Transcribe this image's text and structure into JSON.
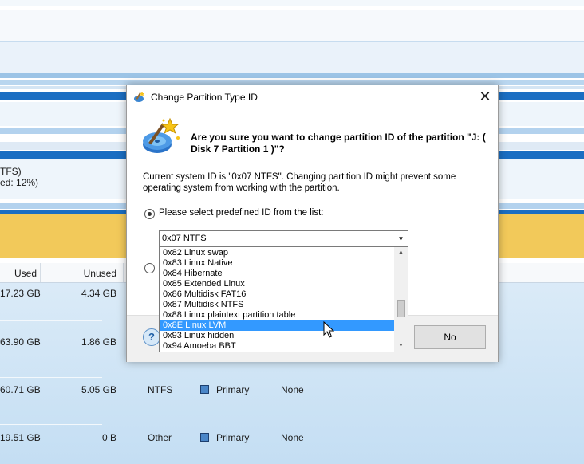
{
  "background": {
    "partition_text_line1": "TFS)",
    "partition_text_line2": "ed: 12%)",
    "columns": {
      "used": "Used",
      "unused": "Unused"
    },
    "rows": [
      {
        "used": "17.23 GB",
        "unused": "4.34 GB",
        "fs": "",
        "type": "",
        "status": ""
      },
      {
        "used": "63.90 GB",
        "unused": "1.86 GB",
        "fs": "",
        "type": "",
        "status": ""
      },
      {
        "used": "60.71 GB",
        "unused": "5.05 GB",
        "fs": "NTFS",
        "type": "Primary",
        "status": "None"
      },
      {
        "used": "19.51 GB",
        "unused": "0 B",
        "fs": "Other",
        "type": "Primary",
        "status": "None"
      }
    ]
  },
  "dialog": {
    "title": "Change Partition Type ID",
    "question": "Are you sure you want to change partition ID of the partition \"J: ( Disk 7 Partition 1 )\"?",
    "info": "Current system ID is \"0x07 NTFS\". Changing partition ID might prevent some operating system from working with the partition.",
    "radio_predefined_label": "Please select predefined ID from the list:",
    "combo_value": "0x07 NTFS",
    "dropdown_items": [
      "0x82 Linux swap",
      "0x83 Linux Native",
      "0x84 Hibernate",
      "0x85 Extended Linux",
      "0x86 Multidisk FAT16",
      "0x87 Multidisk NTFS",
      "0x88 Linux plaintext partition table",
      "0x8E Linux LVM",
      "0x93 Linux hidden",
      "0x94 Amoeba BBT"
    ],
    "selected_item": "0x8E Linux LVM",
    "help_glyph": "?",
    "no_label": "No",
    "icons": {
      "title": "wizard-icon",
      "main": "magic-wand-disk-icon",
      "close": "close-icon"
    }
  },
  "colors": {
    "accent_blue": "#1b6ec2",
    "selection": "#3399ff",
    "partition_yellow": "#f2c95a"
  }
}
